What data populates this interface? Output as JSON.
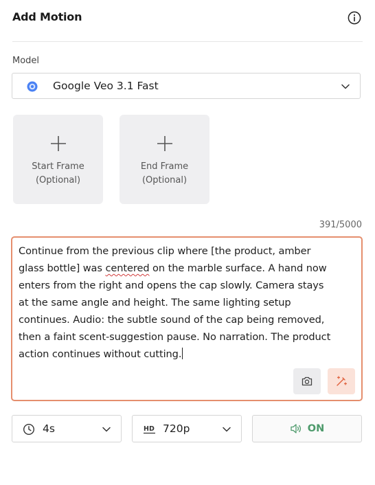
{
  "header": {
    "title": "Add Motion"
  },
  "model": {
    "label": "Model",
    "value": "Google Veo 3.1 Fast"
  },
  "frames": [
    {
      "line1": "Start Frame",
      "line2": "(Optional)"
    },
    {
      "line1": "End Frame",
      "line2": "(Optional)"
    }
  ],
  "prompt": {
    "counter": "391/5000",
    "text": "Continue from the previous clip where [the product, amber glass bottle] was centered on the marble surface. A hand now enters from the right and opens the cap slowly. Camera stays at the same angle and height. The same lighting setup continues. Audio: the subtle sound of the cap being removed, then a faint scent-suggestion pause. No narration. The product action continues without cutting.",
    "lines": [
      "Continue from the previous clip where [the product, amber",
      "glass bottle] was ",
      "centered",
      " on the marble surface. A hand now",
      "enters from the right and opens the cap slowly. Camera stays",
      "at the same angle and height. The same lighting setup",
      "continues. Audio: the subtle sound of the cap being removed,",
      "then a faint scent-suggestion pause. No narration. The product",
      "action continues without cutting."
    ]
  },
  "options": {
    "duration": "4s",
    "resolution": "720p",
    "audio": "ON"
  },
  "icons": {
    "info": "info-icon",
    "model_logo": "veo-logo-icon",
    "chevron": "chevron-down-icon",
    "plus": "plus-icon",
    "camera": "camera-icon",
    "enhance": "magic-wand-icon",
    "clock": "clock-icon",
    "hd": "hd-icon",
    "speaker": "speaker-icon"
  },
  "colors": {
    "accent_border": "#e58e6d",
    "audio_on": "#4d9a6b",
    "enhance_bg": "#fbe2d9",
    "spell_underline": "#d23b3b"
  }
}
